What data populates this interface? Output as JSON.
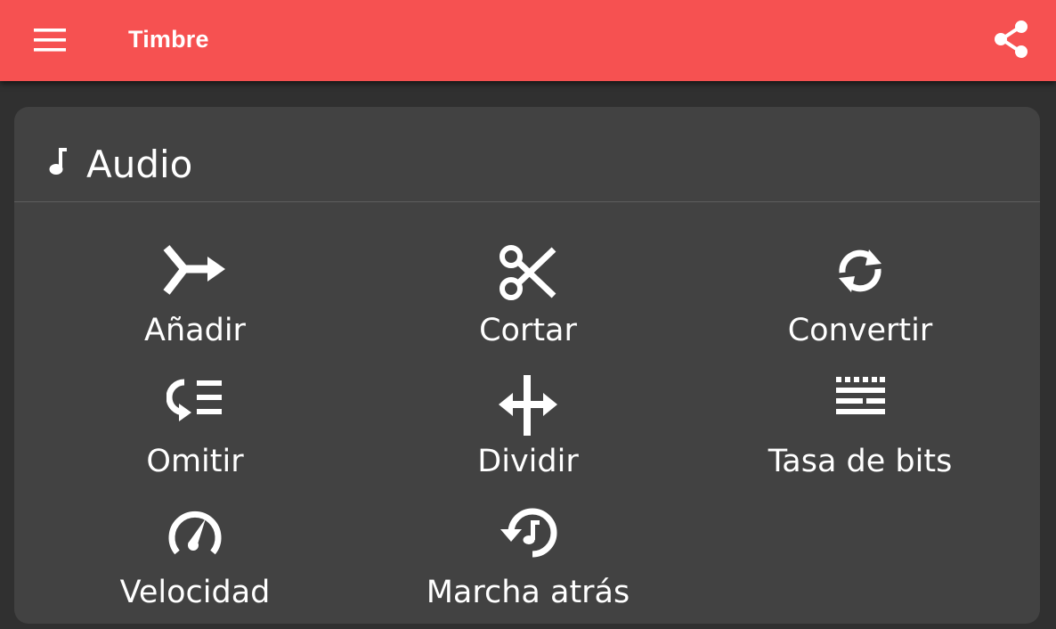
{
  "appbar": {
    "title": "Timbre",
    "menu_icon": "menu-icon",
    "share_icon": "share-icon",
    "color": "#f65151"
  },
  "card": {
    "title": "Audio",
    "icon": "music-note-icon",
    "tools": [
      {
        "label": "Añadir",
        "icon": "merge-arrow-icon"
      },
      {
        "label": "Cortar",
        "icon": "scissors-icon"
      },
      {
        "label": "Convertir",
        "icon": "sync-icon"
      },
      {
        "label": "Omitir",
        "icon": "skip-list-icon"
      },
      {
        "label": "Dividir",
        "icon": "split-arrows-icon"
      },
      {
        "label": "Tasa de bits",
        "icon": "bitrate-icon"
      },
      {
        "label": "Velocidad",
        "icon": "speedometer-icon"
      },
      {
        "label": "Marcha atrás",
        "icon": "reverse-music-icon"
      }
    ]
  },
  "colors": {
    "background": "#303030",
    "card": "#424242",
    "text": "#ffffff"
  }
}
